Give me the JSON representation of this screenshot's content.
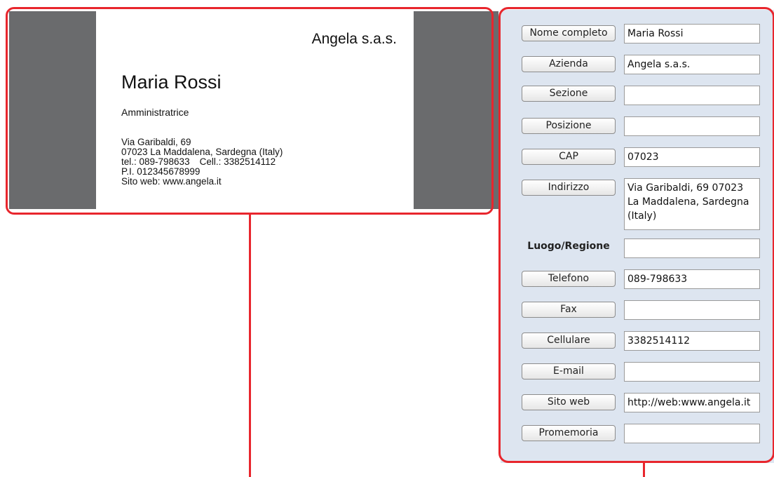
{
  "card": {
    "company": "Angela s.a.s.",
    "name": "Maria Rossi",
    "role": "Amministratrice",
    "address_line": "Via Garibaldi, 69",
    "city_line": "07023 La Maddalena, Sardegna (Italy)",
    "tel_line": "tel.: 089-798633",
    "cell_line": "Cell.: 3382514112",
    "vat_line": "P.I. 012345678999",
    "web_line": "Sito web: www.angela.it"
  },
  "form": {
    "fields": [
      {
        "label": "Nome completo",
        "value": "Maria Rossi"
      },
      {
        "label": "Azienda",
        "value": "Angela s.a.s."
      },
      {
        "label": "Sezione",
        "value": ""
      },
      {
        "label": "Posizione",
        "value": ""
      },
      {
        "label": "CAP",
        "value": "07023"
      },
      {
        "label": "Indirizzo",
        "value": "Via Garibaldi, 69 07023 La Maddalena, Sardegna (Italy)"
      },
      {
        "label": "Luogo/Regione",
        "value": ""
      },
      {
        "label": "Telefono",
        "value": "089-798633"
      },
      {
        "label": "Fax",
        "value": ""
      },
      {
        "label": "Cellulare",
        "value": "3382514112"
      },
      {
        "label": "E-mail",
        "value": ""
      },
      {
        "label": "Sito web",
        "value": "http://web:www.angela.it"
      },
      {
        "label": "Promemoria",
        "value": ""
      }
    ]
  },
  "colors": {
    "highlight": "#e8262d",
    "panel_bg": "#dde5f0",
    "viewer_bg": "#6a6b6d"
  }
}
